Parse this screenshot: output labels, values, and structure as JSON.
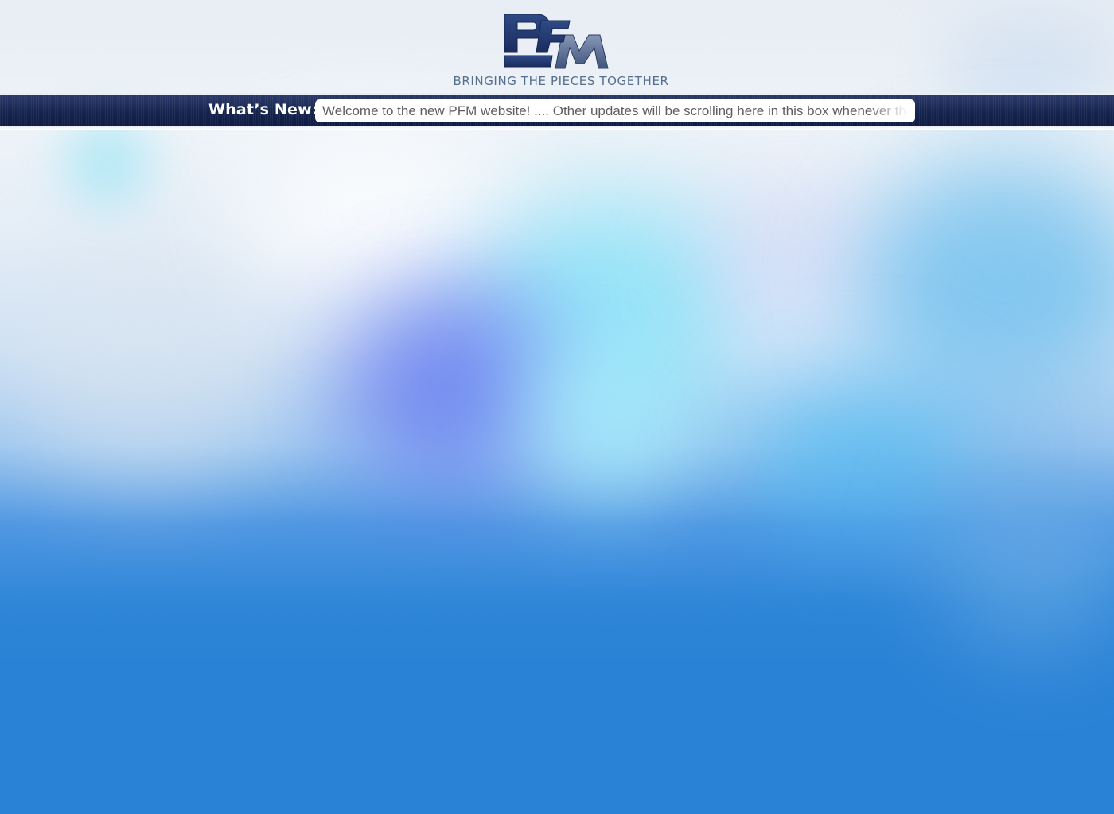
{
  "header": {
    "logo_text": "PFM",
    "tagline": "BRINGING THE PIECES TOGETHER"
  },
  "news": {
    "label": "What’s New:",
    "ticker_text": "Welcome to the new PFM website! .... Other updates will be scrolling here in this box whenever there is news."
  },
  "colors": {
    "logo_navy": "#1f3467",
    "logo_slate": "#5a6f96",
    "tagline": "#566f8f",
    "news_bar": "#16254f",
    "background_blue": "#2a82d6"
  }
}
